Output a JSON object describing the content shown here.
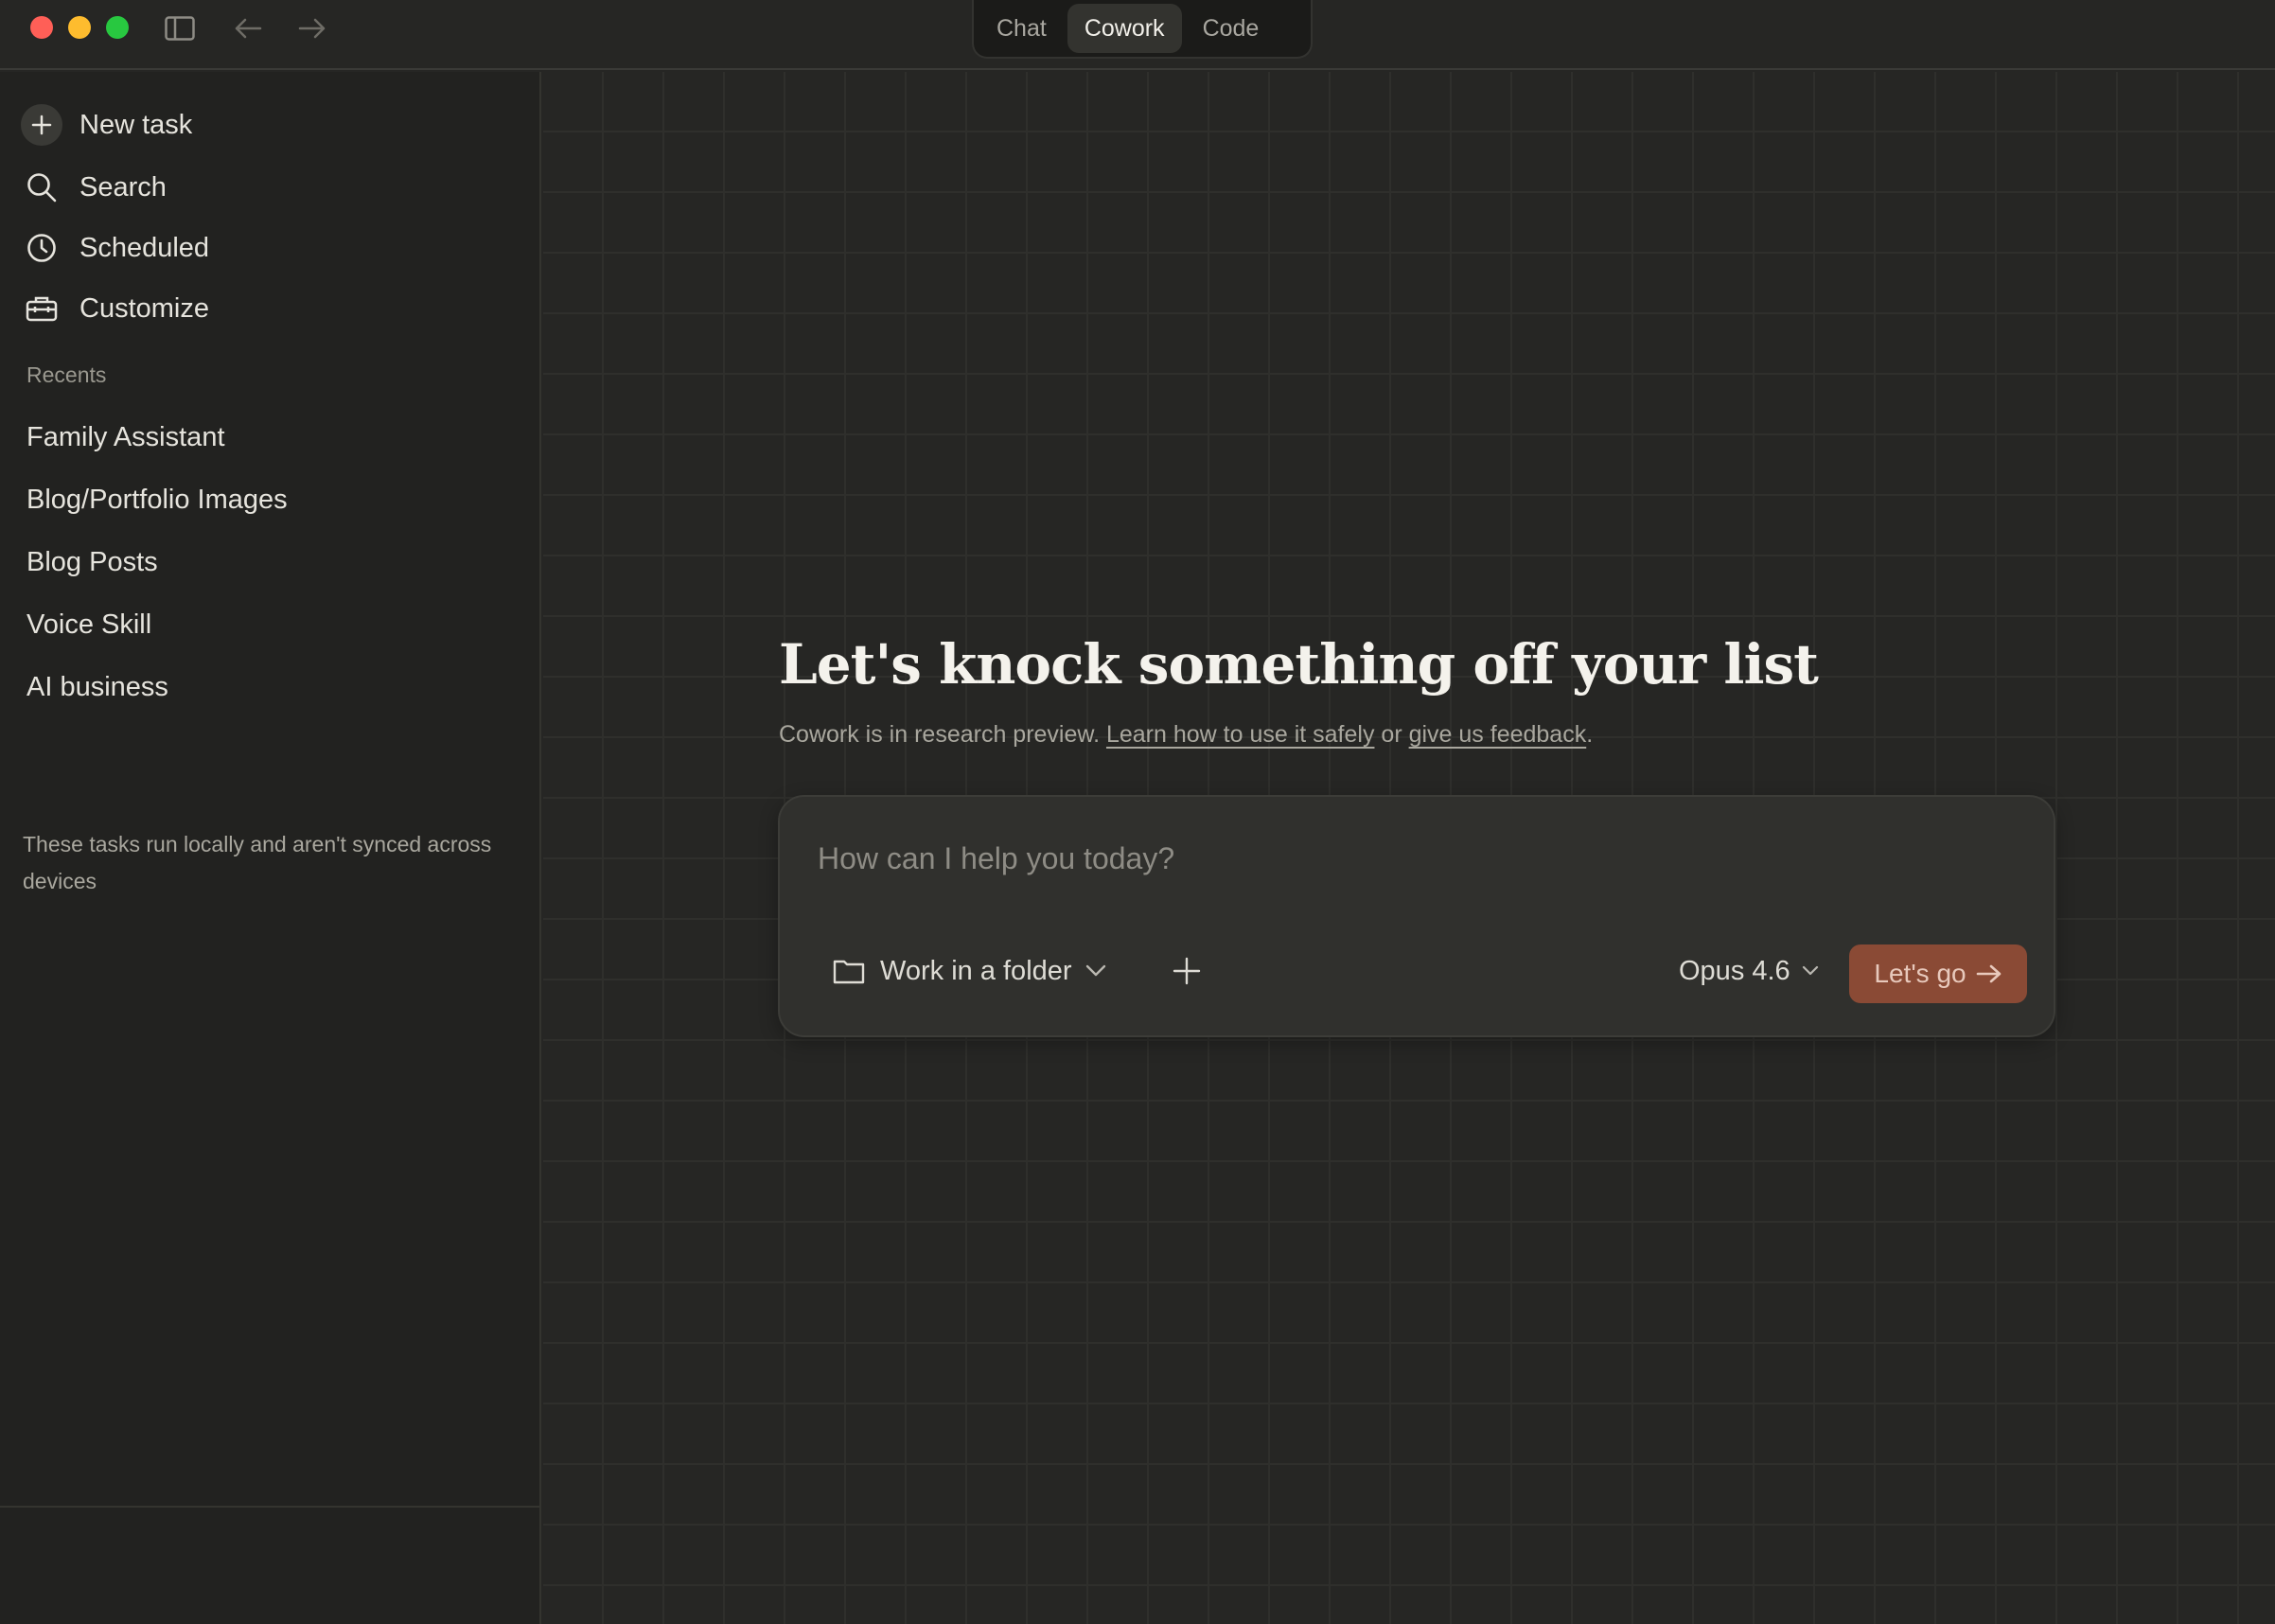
{
  "window": {
    "mode_tabs": [
      {
        "label": "Chat",
        "active": false
      },
      {
        "label": "Cowork",
        "active": true
      },
      {
        "label": "Code",
        "active": false
      }
    ]
  },
  "sidebar": {
    "nav": [
      {
        "label": "New task",
        "icon": "plus-icon"
      },
      {
        "label": "Search",
        "icon": "search-icon"
      },
      {
        "label": "Scheduled",
        "icon": "clock-icon"
      },
      {
        "label": "Customize",
        "icon": "briefcase-icon"
      }
    ],
    "recents_label": "Recents",
    "recents": [
      "Family Assistant",
      "Blog/Portfolio Images",
      "Blog Posts",
      "Voice Skill",
      "AI business"
    ],
    "note": "These tasks run locally and aren't synced across devices"
  },
  "main": {
    "title": "Let's knock something off your list",
    "subtitle_prefix": "Cowork is in research preview. ",
    "subtitle_link1": "Learn how to use it safely",
    "subtitle_mid": " or ",
    "subtitle_link2": "give us feedback",
    "subtitle_suffix": ".",
    "composer": {
      "placeholder": "How can I help you today?",
      "folder_label": "Work in a folder",
      "model_label": "Opus 4.6",
      "submit_label": "Let's go"
    }
  },
  "colors": {
    "background": "#262624",
    "sidebar": "#222220",
    "accent_button": "#8a4a35",
    "close": "#ff5f57",
    "minimize": "#febc2e",
    "maximize": "#28c840"
  }
}
